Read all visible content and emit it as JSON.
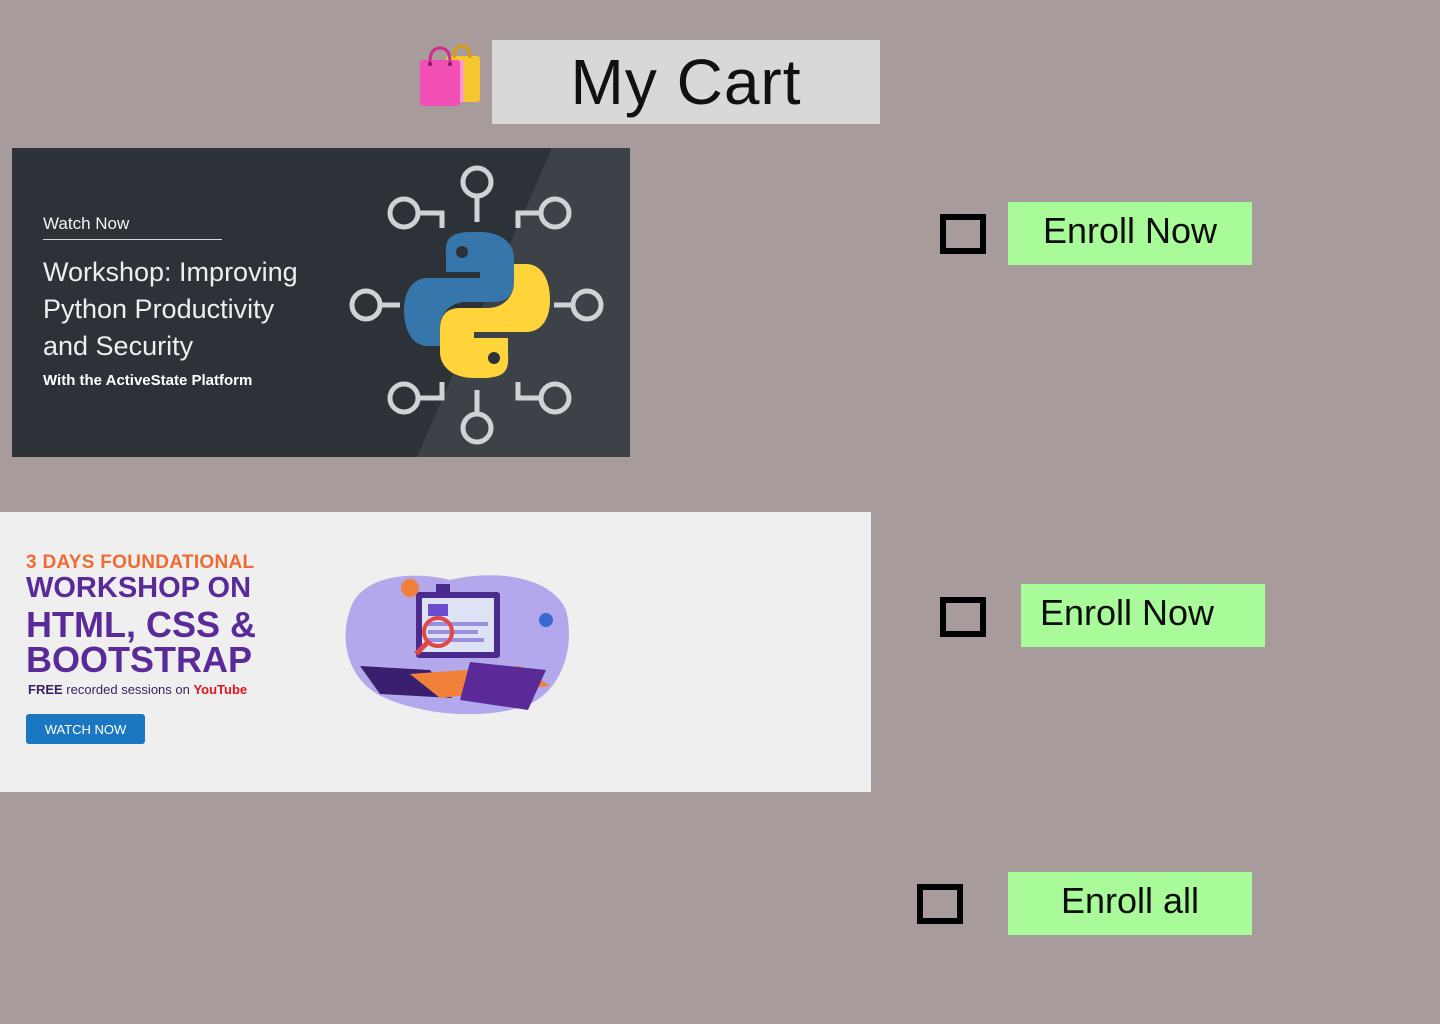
{
  "header": {
    "title": "My Cart",
    "icon": "shopping-bags-icon"
  },
  "cart_items": [
    {
      "banner": {
        "watch_label": "Watch Now",
        "title": "Workshop: Improving Python Productivity and Security",
        "subtitle": "With the ActiveState Platform",
        "art": "python-logo-network-icon"
      },
      "enroll_label": "Enroll Now"
    },
    {
      "banner": {
        "kicker": "3 DAYS FOUNDATIONAL",
        "line1": "WORKSHOP ON",
        "line2": "HTML, CSS &",
        "line3": "BOOTSTRAP",
        "free": "FREE",
        "free_rest": " recorded sessions on ",
        "youtube": "YouTube",
        "button": "WATCH NOW",
        "art": "computer-illustration-icon"
      },
      "enroll_label": "Enroll Now"
    }
  ],
  "enroll_all_label": "Enroll all",
  "colors": {
    "background": "#a89b9b",
    "button": "#a8fb98",
    "title_box": "#d8d8d8"
  }
}
